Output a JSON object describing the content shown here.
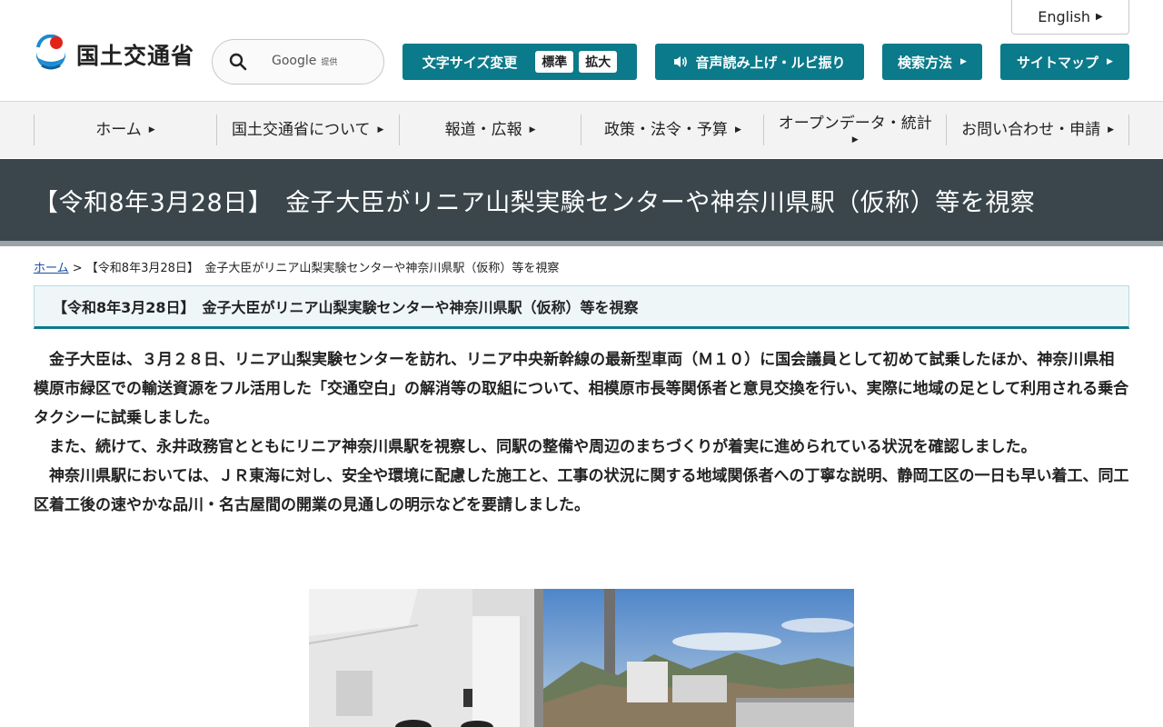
{
  "header": {
    "language_label": "English",
    "logo_text": "国土交通省",
    "search": {
      "brand": "Google",
      "brand_sub": "提供"
    },
    "font_size": {
      "label": "文字サイズ変更",
      "standard": "標準",
      "large": "拡大"
    },
    "voice_label": "音声読み上げ・ルビ振り",
    "search_method_label": "検索方法",
    "sitemap_label": "サイトマップ"
  },
  "nav": [
    {
      "label": "ホーム"
    },
    {
      "label": "国土交通省について"
    },
    {
      "label": "報道・広報"
    },
    {
      "label": "政策・法令・予算"
    },
    {
      "label": "オープンデータ・統計"
    },
    {
      "label": "お問い合わせ・申請"
    }
  ],
  "page": {
    "title": "【令和8年3月28日】　金子大臣がリニア山梨実験センターや神奈川県駅（仮称）等を視察",
    "breadcrumb": {
      "home": "ホーム",
      "separator": " > ",
      "current": "【令和8年3月28日】　金子大臣がリニア山梨実験センターや神奈川県駅（仮称）等を視察"
    },
    "heading": "【令和8年3月28日】　金子大臣がリニア山梨実験センターや神奈川県駅（仮称）等を視察",
    "paragraphs": [
      "金子大臣は、３月２８日、リニア山梨実験センターを訪れ、リニア中央新幹線の最新型車両（Ｍ１０）に国会議員として初めて試乗したほか、神奈川県相模原市緑区での輸送資源をフル活用した「交通空白」の解消等の取組について、相模原市長等関係者と意見交換を行い、実際に地域の足として利用される乗合タクシーに試乗しました。",
      "また、続けて、永井政務官とともにリニア神奈川県駅を視察し、同駅の整備や周辺のまちづくりが着実に進められている状況を確認しました。",
      "神奈川県駅においては、ＪＲ東海に対し、安全や環境に配慮した施工と、工事の状況に関する地域関係者への丁寧な説明、静岡工区の一日も早い着工、同工区着工後の速やかな品川・名古屋間の開業の見通しの明示などを要請しました。"
    ]
  },
  "colors": {
    "accent": "#0b7a8a",
    "title_band": "#3a464b",
    "nav_bg": "#f3f3f3"
  },
  "icons": [
    "mlit-logo-icon",
    "search-icon",
    "speaker-icon",
    "triangle-right-icon"
  ]
}
